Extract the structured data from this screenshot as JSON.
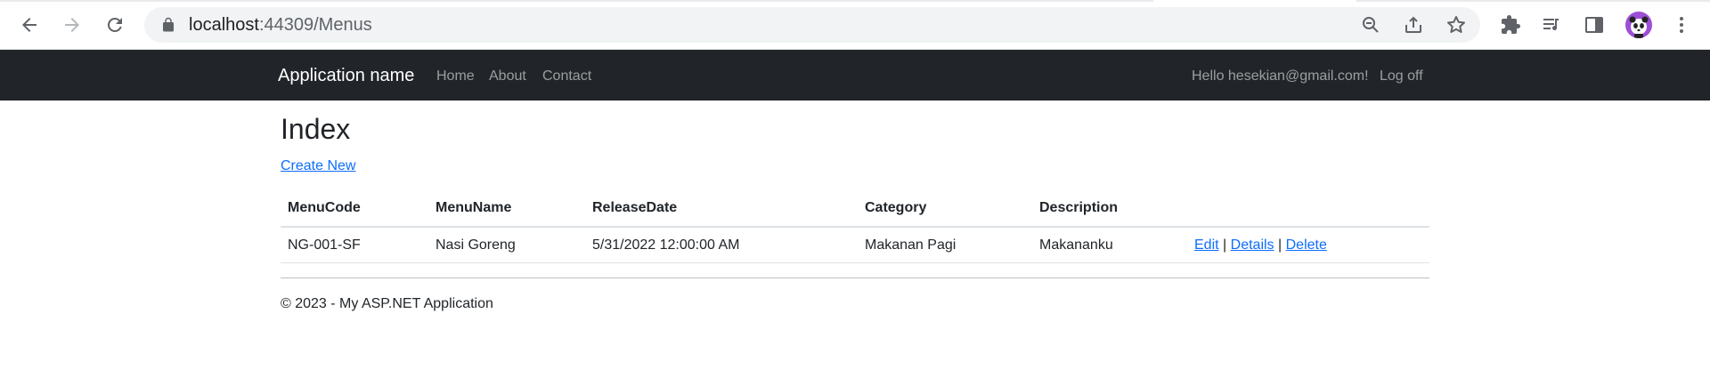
{
  "browser": {
    "url_host": "localhost",
    "url_rest": ":44309/Menus",
    "icons": {
      "back": "arrow-left-icon",
      "forward": "arrow-right-icon",
      "reload": "reload-icon",
      "lock": "lock-icon",
      "zoom": "zoom-out-icon",
      "share": "share-icon",
      "bookmark": "star-icon",
      "extensions": "puzzle-icon",
      "media": "media-queue-icon",
      "side_panel": "side-panel-icon",
      "profile": "avatar",
      "menu": "kebab-menu-icon"
    }
  },
  "navbar": {
    "brand": "Application name",
    "links": [
      "Home",
      "About",
      "Contact"
    ],
    "greeting": "Hello hesekian@gmail.com!",
    "logoff": "Log off"
  },
  "page": {
    "title": "Index",
    "create_link": "Create New"
  },
  "table": {
    "headers": [
      "MenuCode",
      "MenuName",
      "ReleaseDate",
      "Category",
      "Description"
    ],
    "rows": [
      {
        "cells": [
          "NG-001-SF",
          "Nasi Goreng",
          "5/31/2022 12:00:00 AM",
          "Makanan Pagi",
          "Makananku"
        ],
        "actions": [
          "Edit",
          "Details",
          "Delete"
        ],
        "separator": "|"
      }
    ]
  },
  "footer": {
    "text": "© 2023 - My ASP.NET Application"
  },
  "colors": {
    "navbar_bg": "#212529",
    "link": "#0d6efd",
    "text": "#212529",
    "avatar_bg": "#9c4fd6"
  }
}
